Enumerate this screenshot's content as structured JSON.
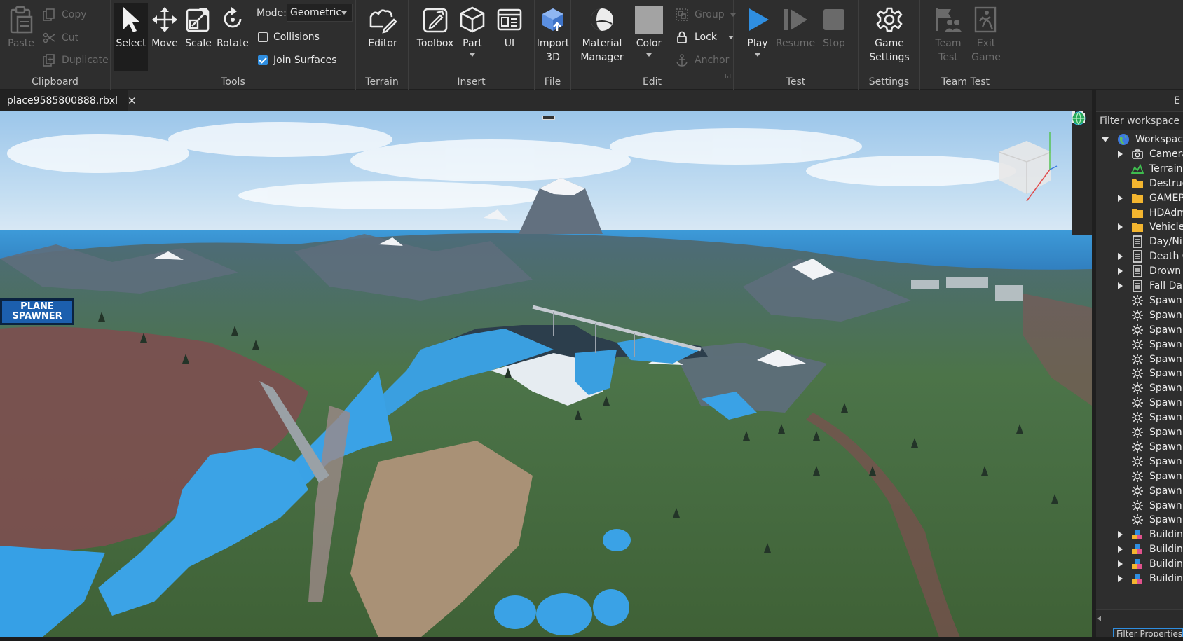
{
  "ribbon": {
    "clipboard": {
      "label": "Clipboard",
      "paste": "Paste",
      "copy": "Copy",
      "cut": "Cut",
      "duplicate": "Duplicate"
    },
    "tools": {
      "label": "Tools",
      "select": "Select",
      "move": "Move",
      "scale": "Scale",
      "rotate": "Rotate",
      "mode_label": "Mode:",
      "mode_value": "Geometric",
      "collisions": "Collisions",
      "collisions_checked": false,
      "join_surfaces": "Join Surfaces",
      "join_surfaces_checked": true
    },
    "terrain": {
      "label": "Terrain",
      "editor": "Editor"
    },
    "insert": {
      "label": "Insert",
      "toolbox": "Toolbox",
      "part": "Part",
      "ui": "UI"
    },
    "file": {
      "label": "File",
      "import_3d_line1": "Import",
      "import_3d_line2": "3D"
    },
    "edit": {
      "label": "Edit",
      "material_manager_line1": "Material",
      "material_manager_line2": "Manager",
      "color": "Color",
      "group": "Group",
      "lock": "Lock",
      "anchor": "Anchor"
    },
    "test": {
      "label": "Test",
      "play": "Play",
      "resume": "Resume",
      "stop": "Stop"
    },
    "settings": {
      "label": "Settings",
      "game_settings_line1": "Game",
      "game_settings_line2": "Settings"
    },
    "team_test": {
      "label": "Team Test",
      "team_test_line1": "Team",
      "team_test_line2": "Test",
      "exit_game_line1": "Exit",
      "exit_game_line2": "Game"
    }
  },
  "tabs": [
    {
      "label": "place9585800888.rbxl",
      "close": "✕"
    }
  ],
  "viewport": {
    "plane_spawner_line1": "PLANE",
    "plane_spawner_line2": "SPAWNER"
  },
  "explorer": {
    "title": "E",
    "filter_placeholder": "Filter workspace (C",
    "tree": [
      {
        "label": "Workspace",
        "icon": "globe-icon",
        "expand": "expanded"
      },
      {
        "label": "Camera",
        "icon": "camera-icon",
        "expand": "collapsed"
      },
      {
        "label": "Terrain",
        "icon": "terrain-icon",
        "expand": "none"
      },
      {
        "label": "Destructi",
        "icon": "folder-icon",
        "expand": "none"
      },
      {
        "label": "GAMEP",
        "icon": "folder-icon",
        "expand": "collapsed"
      },
      {
        "label": "HDAdm",
        "icon": "folder-icon",
        "expand": "none"
      },
      {
        "label": "Vehicle",
        "icon": "folder-icon",
        "expand": "collapsed"
      },
      {
        "label": "Day/Ni",
        "icon": "script-icon",
        "expand": "none"
      },
      {
        "label": "Death C",
        "icon": "script-icon",
        "expand": "collapsed"
      },
      {
        "label": "Drown",
        "icon": "script-icon",
        "expand": "collapsed"
      },
      {
        "label": "Fall Da",
        "icon": "script-icon",
        "expand": "collapsed"
      },
      {
        "label": "Spawn",
        "icon": "spawn-icon",
        "expand": "none"
      },
      {
        "label": "Spawn",
        "icon": "spawn-icon",
        "expand": "none"
      },
      {
        "label": "Spawn",
        "icon": "spawn-icon",
        "expand": "none"
      },
      {
        "label": "Spawn",
        "icon": "spawn-icon",
        "expand": "none"
      },
      {
        "label": "Spawn",
        "icon": "spawn-icon",
        "expand": "none"
      },
      {
        "label": "Spawn",
        "icon": "spawn-icon",
        "expand": "none"
      },
      {
        "label": "Spawn",
        "icon": "spawn-icon",
        "expand": "none"
      },
      {
        "label": "Spawn",
        "icon": "spawn-icon",
        "expand": "none"
      },
      {
        "label": "Spawn",
        "icon": "spawn-icon",
        "expand": "none"
      },
      {
        "label": "Spawn",
        "icon": "spawn-icon",
        "expand": "none"
      },
      {
        "label": "Spawn",
        "icon": "spawn-icon",
        "expand": "none"
      },
      {
        "label": "Spawn",
        "icon": "spawn-icon",
        "expand": "none"
      },
      {
        "label": "Spawn",
        "icon": "spawn-icon",
        "expand": "none"
      },
      {
        "label": "Spawn",
        "icon": "spawn-icon",
        "expand": "none"
      },
      {
        "label": "Spawn",
        "icon": "spawn-icon",
        "expand": "none"
      },
      {
        "label": "Spawn",
        "icon": "spawn-icon",
        "expand": "none"
      },
      {
        "label": "Buildin",
        "icon": "model-icon",
        "expand": "collapsed"
      },
      {
        "label": "Buildin",
        "icon": "model-icon",
        "expand": "collapsed"
      },
      {
        "label": "Buildin",
        "icon": "model-icon",
        "expand": "collapsed"
      },
      {
        "label": "Buildin",
        "icon": "model-icon",
        "expand": "collapsed"
      }
    ],
    "properties_filter_placeholder": "Filter Properties"
  },
  "colors": {
    "accent": "#2f8ee0",
    "play": "#2f8ee0",
    "folder": "#f3b52f",
    "terrain": "#3fbf4f",
    "color_swatch": "#a3a3a3"
  }
}
